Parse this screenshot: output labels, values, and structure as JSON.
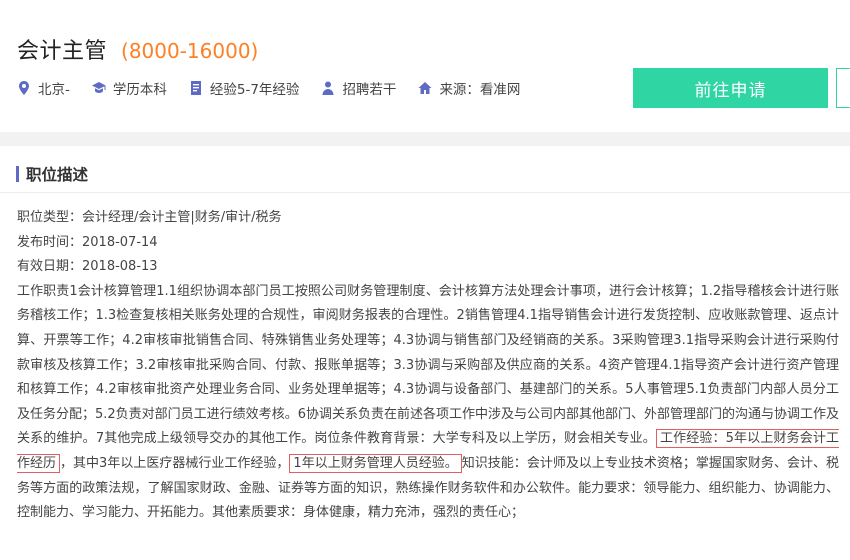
{
  "job": {
    "title": "会计主管",
    "salary": "(8000-16000)",
    "location": "北京-",
    "education": "学历本科",
    "experience": "经验5-7年经验",
    "headcount": "招聘若干",
    "source": "来源：看准网",
    "apply_label": "前往申请"
  },
  "description": {
    "section_title": "职位描述",
    "category": "职位类型：会计经理/会计主管|财务/审计/税务",
    "publish_date": "发布时间：2018-07-14",
    "valid_date": "有效日期：2018-08-13",
    "body_before": "工作职责1会计核算管理1.1组织协调本部门员工按照公司财务管理制度、会计核算方法处理会计事项，进行会计核算；1.2指导稽核会计进行账务稽核工作；1.3检查复核相关账务处理的合规性，审阅财务报表的合理性。2销售管理4.1指导销售会计进行发货控制、应收账款管理、返点计算、开票等工作；4.2审核审批销售合同、特殊销售业务处理等；4.3协调与销售部门及经销商的关系。3采购管理3.1指导采购会计进行采购付款审核及核算工作；3.2审核审批采购合同、付款、报账单据等；3.3协调与采购部及供应商的关系。4资产管理4.1指导资产会计进行资产管理和核算工作；4.2审核审批资产处理业务合同、业务处理单据等；4.3协调与设备部门、基建部门的关系。5人事管理5.1负责部门内部人员分工及任务分配；5.2负责对部门员工进行绩效考核。6协调关系负责在前述各项工作中涉及与公司内部其他部门、外部管理部门的沟通与协调工作及关系的维护。7其他完成上级领导交办的其他工作。岗位条件教育背景：大学专科及以上学历，财会相关专业。",
    "highlight_1": "工作经验：5年以上财务会计工作经历",
    "body_middle": "，其中3年以上医疗器械行业工作经验，",
    "highlight_2": "1年以上财务管理人员经验。",
    "body_after": "知识技能：会计师及以上专业技术资格；掌握国家财务、会计、税务等方面的政策法规，了解国家财政、金融、证券等方面的知识，熟练操作财务软件和办公软件。能力要求：领导能力、组织能力、协调能力、控制能力、学习能力、开拓能力。其他素质要求：身体健康，精力充沛，强烈的责任心；"
  },
  "colors": {
    "accent": "#2fd5a3",
    "salary": "#ff7f24",
    "icon": "#5d6bc4",
    "highlight_border": "#e06060"
  },
  "icons": [
    "location-pin-icon",
    "graduation-cap-icon",
    "document-icon",
    "person-icon",
    "home-icon"
  ]
}
